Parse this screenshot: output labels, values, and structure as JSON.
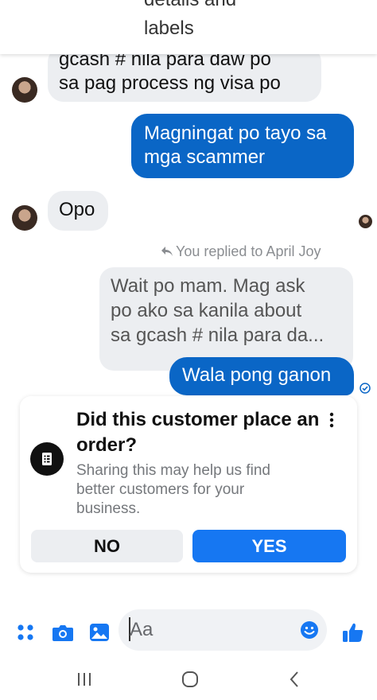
{
  "header": {
    "line1": "details and",
    "line2": "labels"
  },
  "messages": {
    "incoming1_line1": "gcash # nila para daw po",
    "incoming1_line2": "sa pag process ng visa po",
    "outgoing1_line1": "Magningat po tayo sa",
    "outgoing1_line2": "mga scammer",
    "incoming2": "Opo",
    "replied_label": "You replied to April Joy",
    "quoted_line1": "Wait po mam. Mag ask",
    "quoted_line2": "po ako sa kanila about",
    "quoted_line3": "sa gcash # nila para da...",
    "outgoing2": "Wala pong ganon"
  },
  "order_card": {
    "title": "Did this customer place an order?",
    "subtitle": "Sharing this may help us find better customers for your business.",
    "no_label": "NO",
    "yes_label": "YES"
  },
  "composer": {
    "placeholder": "Aa"
  },
  "colors": {
    "outgoing_bubble": "#0a66c6",
    "incoming_bubble": "#eceef1",
    "accent": "#1677f2"
  },
  "icons": [
    "apps-icon",
    "camera-icon",
    "gallery-icon",
    "emoji-icon",
    "thumbs-up-icon",
    "recent-apps-icon",
    "home-icon",
    "back-icon",
    "more-options-icon",
    "order-icon",
    "reply-arrow-icon",
    "delivered-check-icon"
  ]
}
